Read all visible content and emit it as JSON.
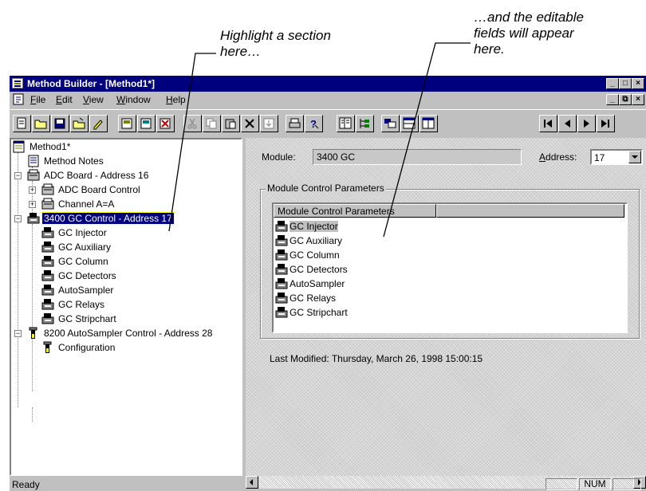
{
  "annotations": {
    "left": "Highlight a section\nhere…",
    "right": "…and the editable\nfields will appear\nhere."
  },
  "window": {
    "title": "Method Builder - [Method1*]",
    "buttons": [
      "_",
      "□",
      "×"
    ]
  },
  "menu": {
    "items": [
      {
        "label": "File",
        "hotkey": "F",
        "rest": "ile"
      },
      {
        "label": "Edit",
        "hotkey": "E",
        "rest": "dit"
      },
      {
        "label": "View",
        "hotkey": "V",
        "rest": "iew"
      },
      {
        "label": "Window",
        "hotkey": "W",
        "rest": "indow"
      },
      {
        "label": "Help",
        "hotkey": "H",
        "rest": "elp"
      }
    ],
    "mdi_buttons": [
      "_",
      "⧉",
      "×"
    ]
  },
  "toolbar": {
    "buttons": [
      "new-icon",
      "open-icon",
      "save-icon",
      "open-method-icon",
      "edit-icon",
      "copy-method-icon",
      "paste-method-icon",
      "delete-method-icon",
      "cut-icon",
      "copy-icon",
      "paste-icon",
      "delete-icon",
      "properties-icon",
      "print-icon",
      "help-icon",
      "view-split-icon",
      "view-tree-icon",
      "view-detail-icon",
      "view-list-icon",
      "view-columns-icon",
      "first-icon",
      "prev-icon",
      "next-icon",
      "last-icon"
    ]
  },
  "tree": {
    "items": [
      {
        "label": "Method1*",
        "icon": "method-icon"
      },
      {
        "label": "Method Notes",
        "icon": "notes-icon"
      },
      {
        "label": "ADC Board - Address 16",
        "icon": "board-icon"
      },
      {
        "label": "ADC Board Control",
        "icon": "board-icon"
      },
      {
        "label": "Channel A=A",
        "icon": "board-icon"
      },
      {
        "label": "3400 GC Control - Address 17",
        "icon": "gc-icon"
      },
      {
        "label": "GC Injector",
        "icon": "gc-icon"
      },
      {
        "label": "GC Auxiliary",
        "icon": "gc-icon"
      },
      {
        "label": "GC Column",
        "icon": "gc-icon"
      },
      {
        "label": "GC Detectors",
        "icon": "gc-icon"
      },
      {
        "label": "AutoSampler",
        "icon": "gc-icon"
      },
      {
        "label": "GC Relays",
        "icon": "gc-icon"
      },
      {
        "label": "GC Stripchart",
        "icon": "gc-icon"
      },
      {
        "label": "8200 AutoSampler Control - Address 28",
        "icon": "vial-icon"
      },
      {
        "label": "Configuration",
        "icon": "vial-icon"
      }
    ]
  },
  "detail": {
    "module_label": "Module:",
    "module_value": "3400 GC",
    "address_label": "Address:",
    "address_value": "17",
    "group_label": "Module Control Parameters",
    "list_header": "Module Control Parameters",
    "list_items": [
      "GC Injector",
      "GC Auxiliary",
      "GC Column",
      "GC Detectors",
      "AutoSampler",
      "GC Relays",
      "GC Stripchart"
    ],
    "last_modified": "Last Modified:   Thursday, March 26, 1998 15:00:15"
  },
  "status": {
    "text": "Ready",
    "num": "NUM"
  }
}
